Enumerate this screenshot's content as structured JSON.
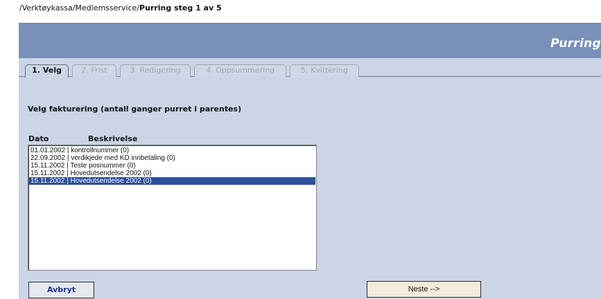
{
  "breadcrumb": {
    "path": "/Verktøykassa/Medlemsservice/",
    "current": "Purring steg 1 av 5"
  },
  "header": {
    "title": "Purring"
  },
  "tabs": [
    {
      "label": "1. Velg",
      "active": true
    },
    {
      "label": "2. Frist",
      "active": false
    },
    {
      "label": "3. Redigering",
      "active": false
    },
    {
      "label": "4. Oppsummering",
      "active": false
    },
    {
      "label": "5. Kvittering",
      "active": false
    }
  ],
  "section_title": "Velg fakturering (antall ganger purret i parentes)",
  "list": {
    "columns": [
      "Dato",
      "Beskrivelse"
    ],
    "items": [
      {
        "text": "01.01.2002 | kontrollnummer (0)",
        "selected": false
      },
      {
        "text": "22.09.2002 | verdikjede med KD innbetaling (0)",
        "selected": false
      },
      {
        "text": "15.11.2002 | Teste posnummer (0)",
        "selected": false
      },
      {
        "text": "15.11.2002 | Hovedutsendelse 2002 (0)",
        "selected": false
      },
      {
        "text": "15.11.2002 | Hovedutsendelse 2002 (0)",
        "selected": true
      }
    ]
  },
  "buttons": {
    "cancel": "Avbryt",
    "next": "Neste -->"
  },
  "colors": {
    "header_bar": "#7990b8",
    "content_bg": "#cbd5e6",
    "selection": "#2d4f9a"
  }
}
